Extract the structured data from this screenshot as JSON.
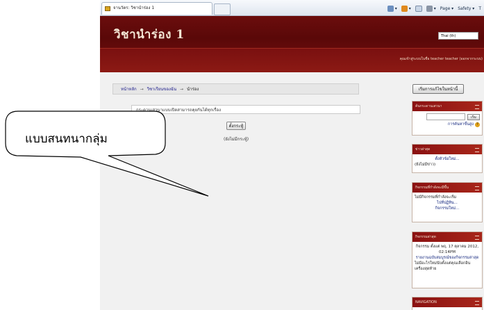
{
  "browser": {
    "tab_title": "จานวัตร: วิชานำร่อง 1",
    "commands": {
      "page_label": "Page ▾",
      "safety_label": "Safety ▾",
      "tools_label": "T"
    }
  },
  "site": {
    "title": "วิชานำร่อง 1",
    "language_select": "Thai (th)",
    "login_info": "คุณเข้าสู่ระบบในชื่อ teacher teacher (ออกจากระบบ)"
  },
  "breadcrumb": {
    "home": "หน้าหลัก",
    "course": "วิชาเรียนของฉัน",
    "current": "นำร่อง"
  },
  "main": {
    "intro": "กระดานเสวนาแบบเปิดสามารถคุยกันได้ทุกเรื่อง",
    "add_topic_label": "ตั้งกระทู้",
    "no_topics": "(ยังไม่มีกระทู้)"
  },
  "sidebar": {
    "edit_button": "เริ่มการแก้ไขในหน้านี้",
    "search_block": {
      "title": "ค้นกระดานเสวนา",
      "go_label": "เริ่ม",
      "advanced_link": "การค้นหาขั้นสูง"
    },
    "news_block": {
      "title": "ข่าวล่าสุด",
      "add_link": "ตั้งหัวข้อใหม่...",
      "empty": "(ยังไม่มีข่าว)"
    },
    "upcoming_block": {
      "title": "กิจกรรมที่กำลังจะมีขึ้น",
      "empty": "ไม่มีกิจกรรมที่กำลังจะเริ่ม",
      "calendar_link": "ไปที่ปฏิทิน...",
      "new_event_link": "กิจกรรมใหม่..."
    },
    "recent_block": {
      "title": "กิจกรรมล่าสุด",
      "since": "กิจกรรม ตั้งแต่ พฤ, 17 ตุลาคม 2012, 02:14PM",
      "report_link": "รายงานฉบับสมบูรณ์ของกิจกรรมล่าสุด",
      "empty": "ไม่มีอะไรใหม่นับตั้งแต่คุณเลือกอินเครื่องสุดท้าย"
    },
    "nav_block": {
      "title": "NAVIGATION"
    }
  },
  "callout": {
    "text": "แบบสนทนากลุ่ม"
  },
  "colors": {
    "header_maroon": "#6b0d0d",
    "block_head": "#8a1111",
    "page_bg": "#f1f1f1"
  }
}
